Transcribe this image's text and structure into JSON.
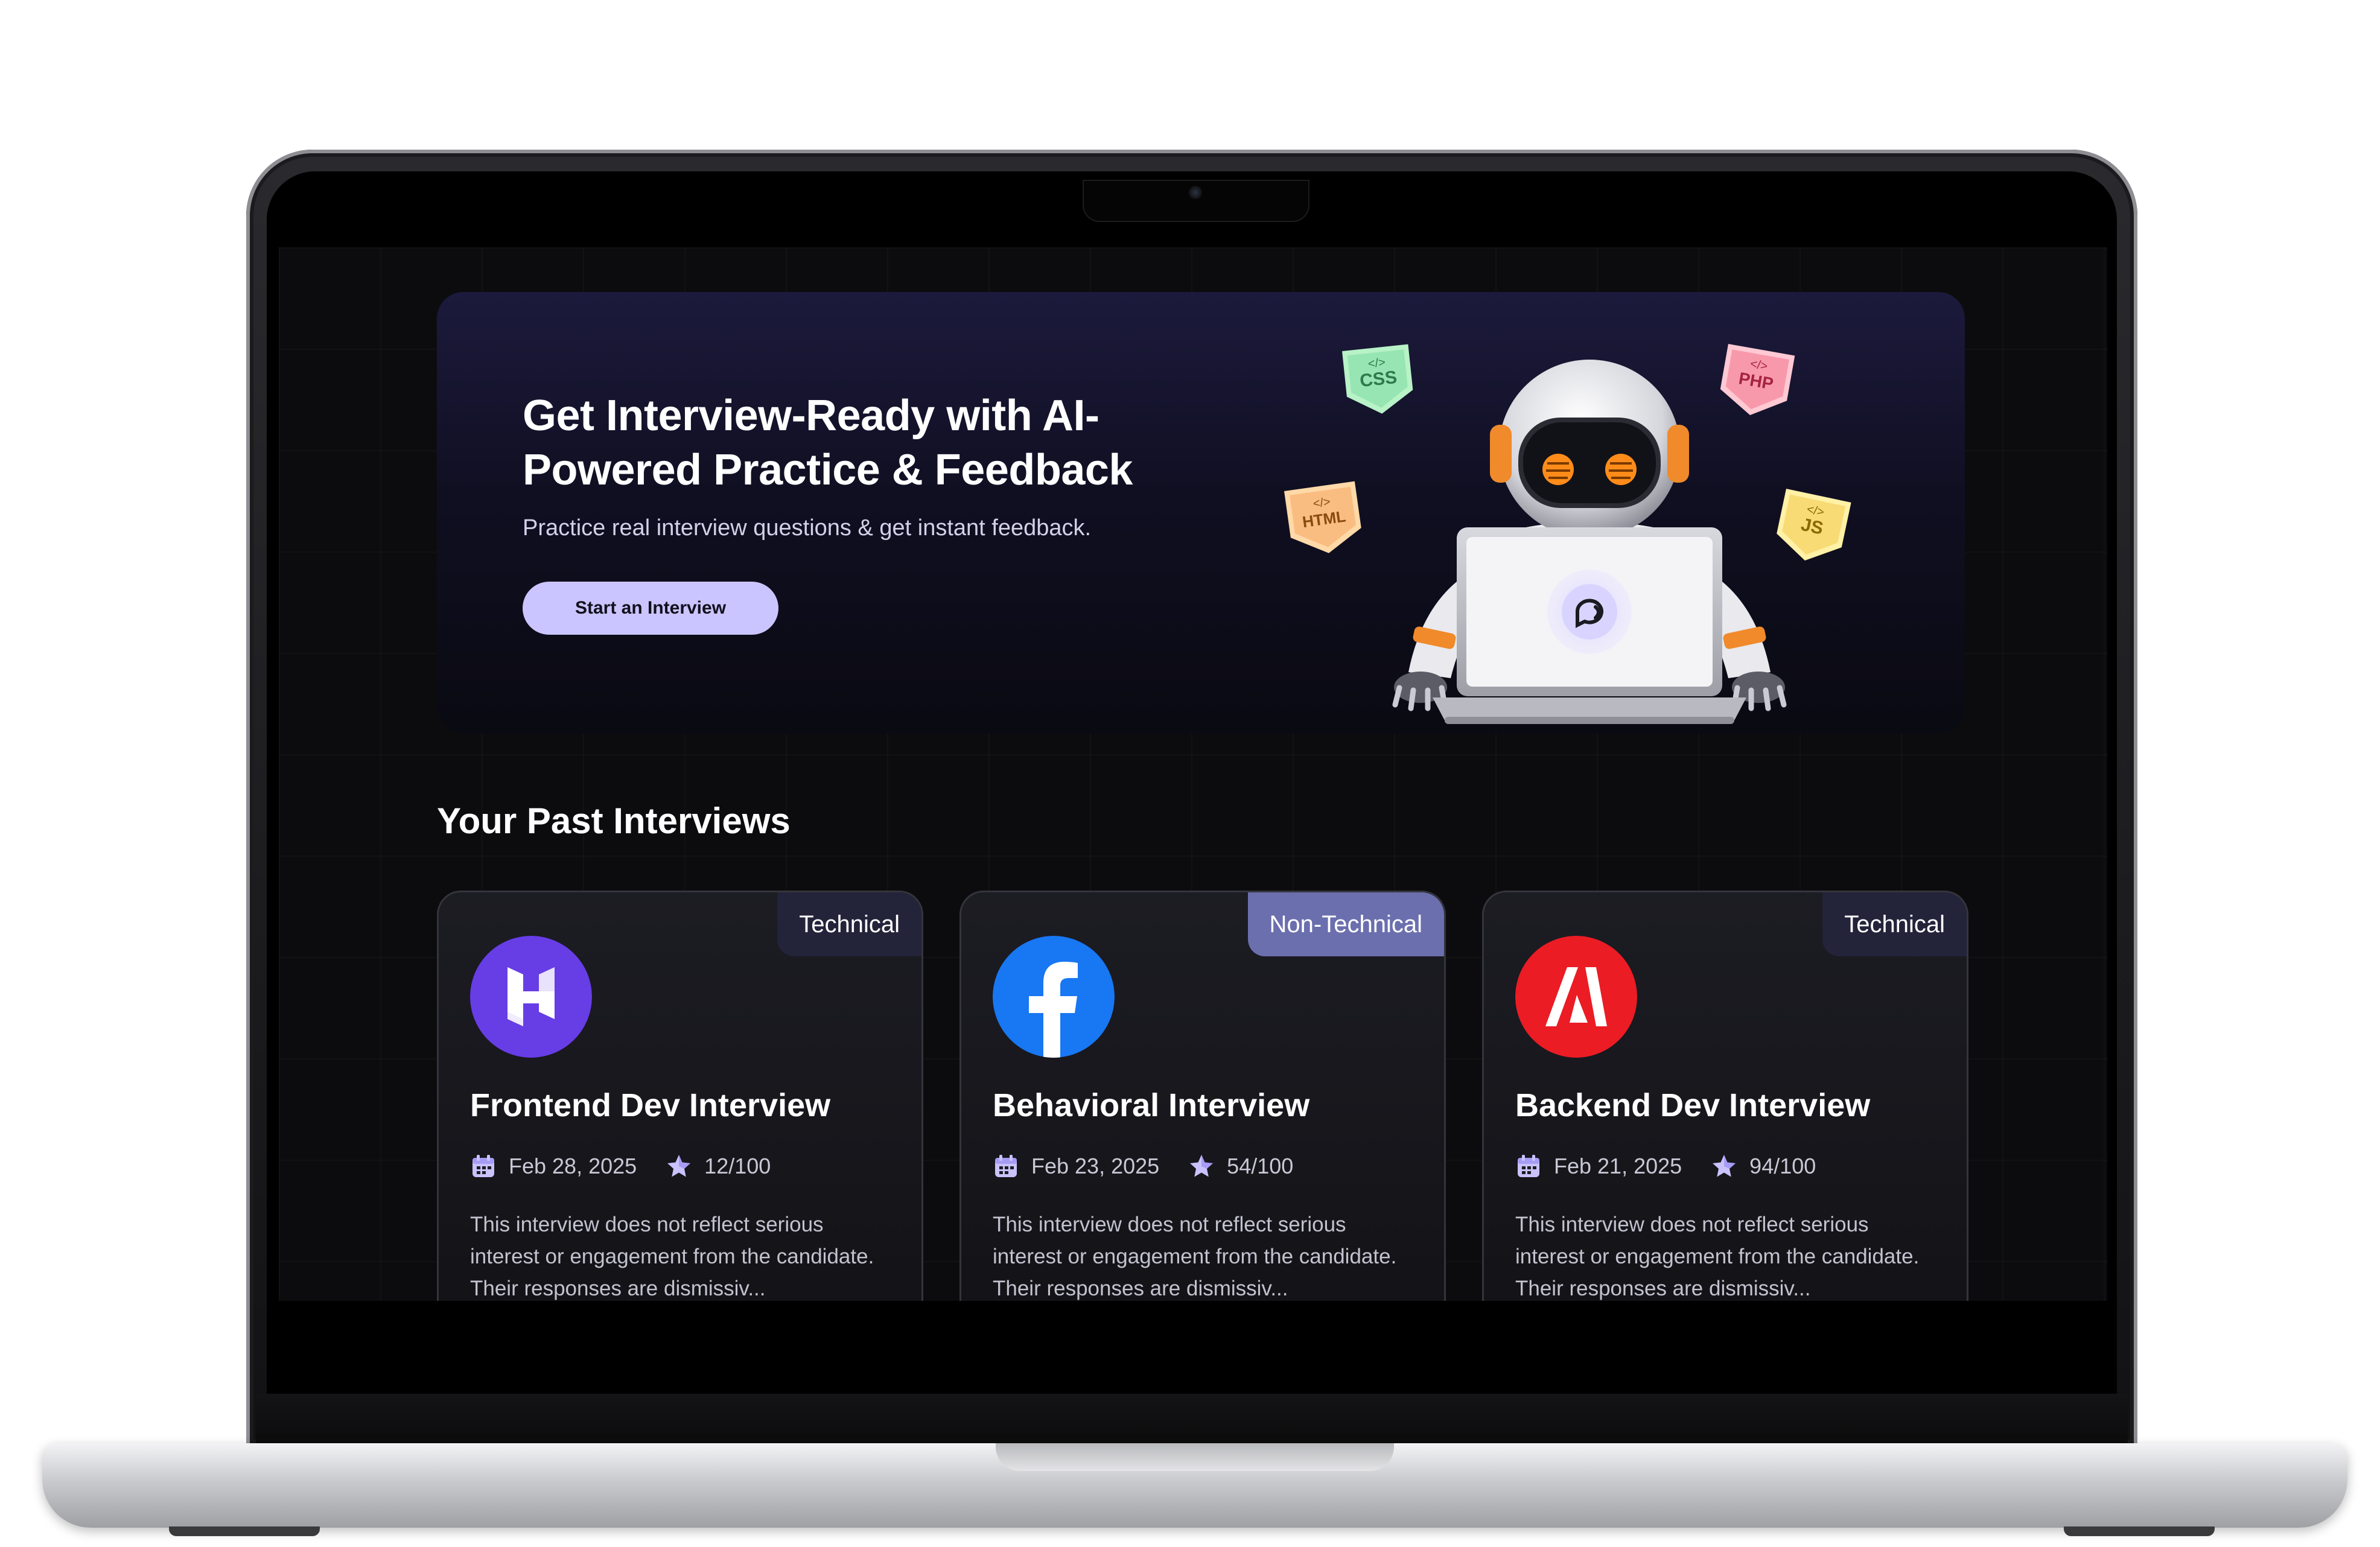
{
  "hero": {
    "title": "Get Interview-Ready with AI-Powered Practice & Feedback",
    "subtitle": "Practice real interview questions & get instant feedback.",
    "cta_label": "Start an Interview",
    "badges": [
      "CSS",
      "PHP",
      "HTML",
      "JS"
    ]
  },
  "past_interviews": {
    "title": "Your Past Interviews",
    "cards": [
      {
        "tag": "Technical",
        "logo_icon": "hostinger-logo-icon",
        "title": "Frontend Dev Interview",
        "date": "Feb 28, 2025",
        "score": "12/100",
        "description": "This interview does not reflect serious interest or engagement from the candidate. Their responses are dismissiv..."
      },
      {
        "tag": "Non-Technical",
        "logo_icon": "facebook-logo-icon",
        "title": "Behavioral Interview",
        "date": "Feb 23, 2025",
        "score": "54/100",
        "description": "This interview does not reflect serious interest or engagement from the candidate. Their responses are dismissiv..."
      },
      {
        "tag": "Technical",
        "logo_icon": "adobe-logo-icon",
        "title": "Backend Dev Interview",
        "date": "Feb 21, 2025",
        "score": "94/100",
        "description": "This interview does not reflect serious interest or engagement from the candidate. Their responses are dismissiv..."
      }
    ]
  },
  "colors": {
    "accent": "#cac5fe",
    "tag_technical": "#23233a",
    "tag_non_technical": "#6b6fae",
    "hostinger": "#673de6",
    "facebook": "#1877f2",
    "adobe": "#eb1c24"
  }
}
